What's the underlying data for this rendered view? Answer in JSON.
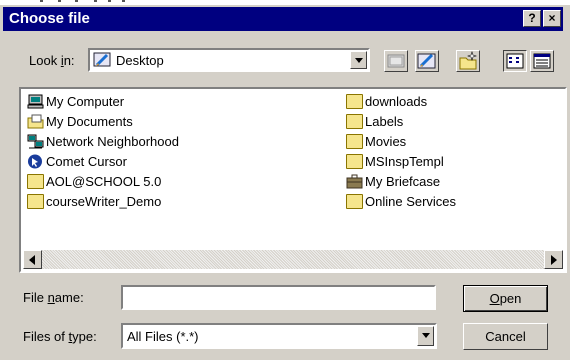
{
  "title": "Choose file",
  "title_buttons": {
    "help": "?",
    "close": "×"
  },
  "look_in": {
    "label_pre": "Look ",
    "label_key": "i",
    "label_post": "n:",
    "value": "Desktop"
  },
  "toolbar_icons": [
    "up-one-level-icon",
    "desktop-icon",
    "new-folder-icon",
    "list-view-icon",
    "details-view-icon"
  ],
  "items": [
    {
      "name": "My Computer",
      "icon": "my-computer-icon"
    },
    {
      "name": "My Documents",
      "icon": "my-documents-icon"
    },
    {
      "name": "Network Neighborhood",
      "icon": "network-neighborhood-icon"
    },
    {
      "name": "Comet Cursor",
      "icon": "comet-cursor-icon"
    },
    {
      "name": "AOL@SCHOOL 5.0",
      "icon": "folder-icon"
    },
    {
      "name": "courseWriter_Demo",
      "icon": "folder-icon"
    },
    {
      "name": "downloads",
      "icon": "folder-icon"
    },
    {
      "name": "Labels",
      "icon": "folder-icon"
    },
    {
      "name": "Movies",
      "icon": "folder-icon"
    },
    {
      "name": "MSInspTempl",
      "icon": "folder-icon"
    },
    {
      "name": "My Briefcase",
      "icon": "briefcase-icon"
    },
    {
      "name": "Online Services",
      "icon": "folder-icon"
    }
  ],
  "file_name": {
    "label_pre": "File ",
    "label_key": "n",
    "label_post": "ame:",
    "value": ""
  },
  "file_type": {
    "label_pre": "Files of ",
    "label_key": "t",
    "label_post": "ype:",
    "value": "All Files (*.*)"
  },
  "buttons": {
    "open_key": "O",
    "open_rest": "pen",
    "cancel": "Cancel"
  }
}
